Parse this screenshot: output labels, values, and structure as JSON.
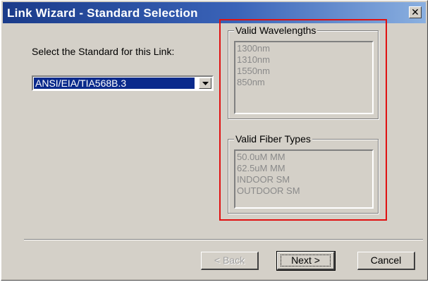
{
  "window": {
    "title": "Link Wizard - Standard Selection",
    "close_glyph": "✕"
  },
  "standard": {
    "label": "Select the Standard for this Link:",
    "selected": "ANSI/EIA/TIA568B.3"
  },
  "wavelengths": {
    "title": "Valid Wavelengths",
    "items": [
      "1300nm",
      "1310nm",
      "1550nm",
      "850nm"
    ]
  },
  "fiber_types": {
    "title": "Valid Fiber Types",
    "items": [
      "50.0uM MM",
      "62.5uM MM",
      "INDOOR SM",
      "OUTDOOR SM"
    ]
  },
  "buttons": {
    "back": "< Back",
    "next": "Next >",
    "cancel": "Cancel"
  },
  "colors": {
    "titlebar": "#1a3b8a",
    "selection": "#0a2a8c",
    "highlight_box": "#e01010",
    "dialog_face": "#d4d0c8"
  }
}
